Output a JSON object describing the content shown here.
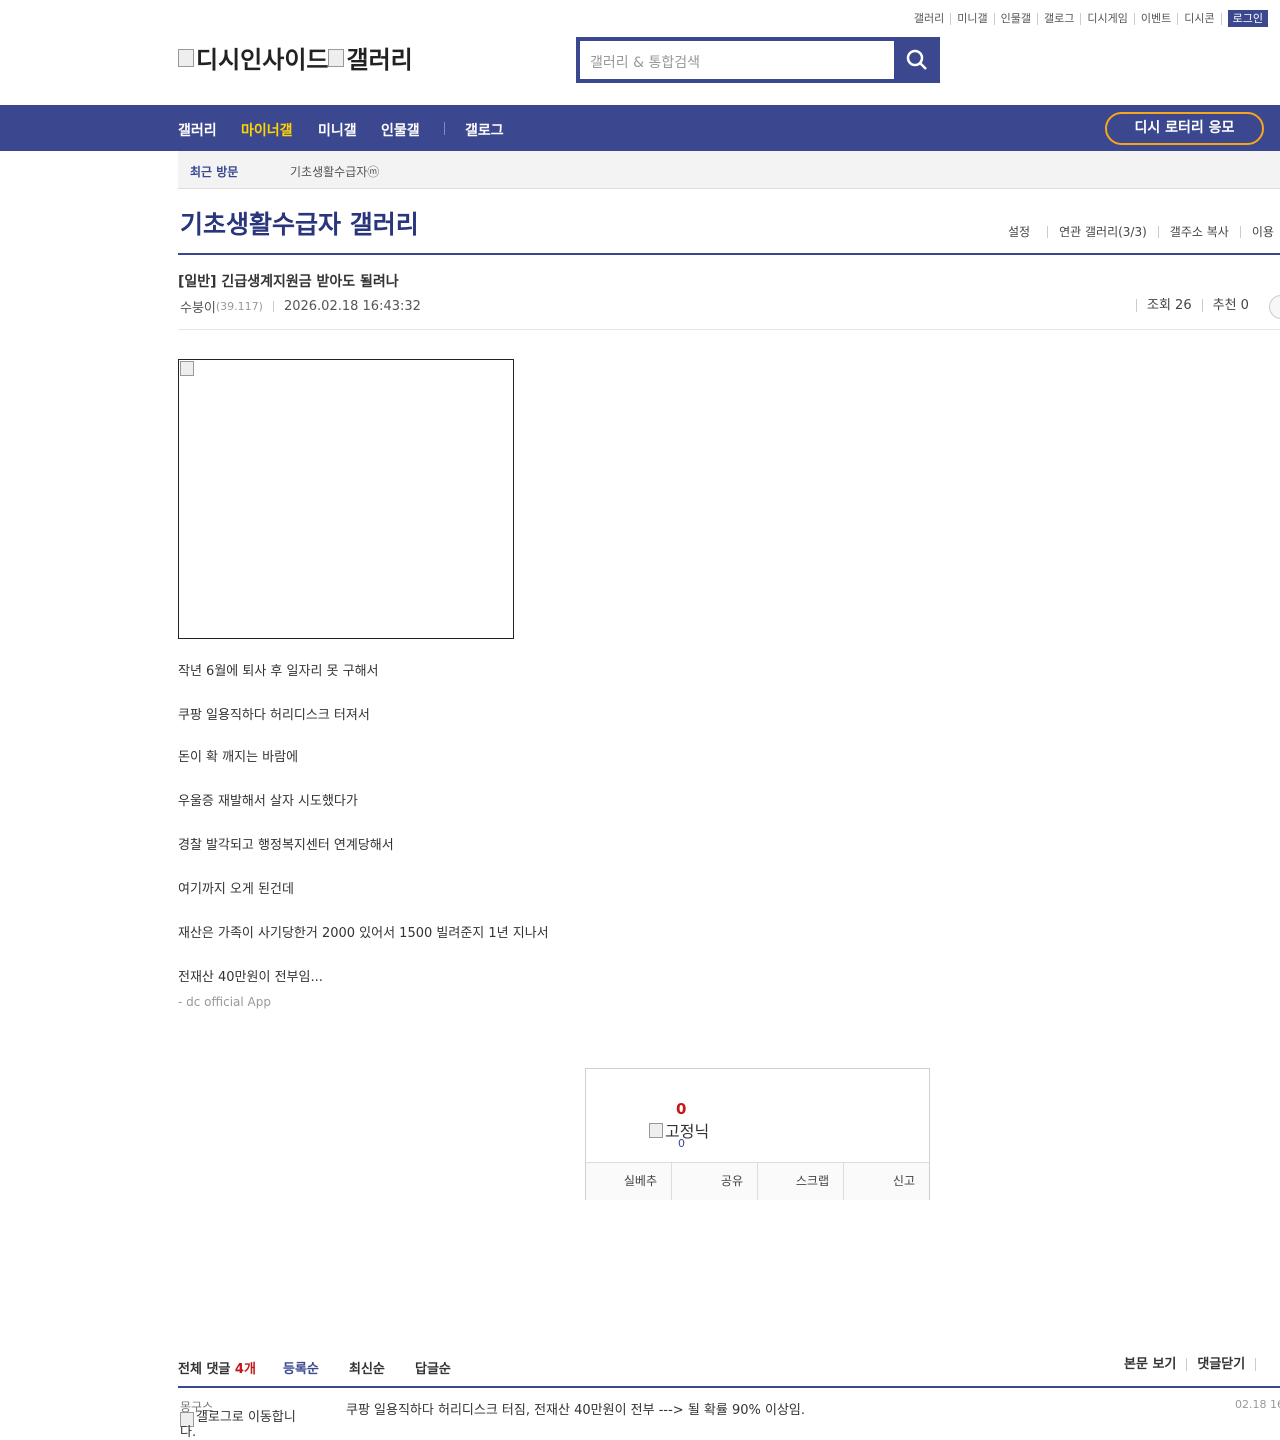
{
  "top_links": [
    "갤러리",
    "미니갤",
    "인물갤",
    "갤로그",
    "디시게임",
    "이벤트",
    "디시콘"
  ],
  "login_label": "로그인",
  "logo": {
    "site_alt": "디시인사이드",
    "gallery_alt": "갤러리"
  },
  "search": {
    "placeholder": "갤러리 & 통합검색"
  },
  "gnb": {
    "items": [
      "갤러리",
      "마이너갤",
      "미니갤",
      "인물갤",
      "갤로그"
    ],
    "active": "마이너갤",
    "lottery": "디시 로터리 응모"
  },
  "recent_visit": {
    "label": "최근 방문",
    "gallery": "기초생활수급자ⓜ"
  },
  "gallery": {
    "title": "기초생활수급자 갤러리",
    "menu": [
      "설정",
      "연관 갤러리(3/3)",
      "갤주소 복사",
      "이용"
    ]
  },
  "post": {
    "title": "[일반] 긴급생계지원금 받아도 될려나",
    "nickname": "수붕이",
    "ip": "(39.117)",
    "date": "2026.02.18 16:43:32",
    "views": "조회 26",
    "recommend": "추천 0",
    "paragraphs": [
      "작년 6월에 퇴사 후 일자리 못 구해서",
      "쿠팡 일용직하다 허리디스크 터져서",
      "돈이 확 깨지는 바람에",
      "우울증 재발해서 살자 시도했다가",
      "경찰 발각되고 행정복지센터 연계당해서",
      "여기까지 오게 된건데",
      "재산은 가족이 사기당한거 2000 있어서 1500 빌려준지 1년 지나서",
      "전재산 40만원이 전부임..."
    ],
    "app_signature": "- dc official App"
  },
  "recommend_box": {
    "count": "0",
    "fixed_nick_alt": "고정닉",
    "fixed_count": "0",
    "buttons": [
      "실베추",
      "공유",
      "스크랩",
      "신고"
    ]
  },
  "comments": {
    "total_label": "전체 댓글",
    "total_count": "4개",
    "sort": [
      "등록순",
      "최신순",
      "답글순"
    ],
    "right": [
      "본문 보기",
      "댓글닫기"
    ],
    "items": [
      {
        "nick": "몽구스",
        "gallog_alt": "갤로그로 이동합니다.",
        "text": "쿠팡 일용직하다 허리디스크 터짐, 전재산 40만원이 전부 ---> 될 확률 90% 이상임.",
        "date": "02.18 16"
      }
    ]
  },
  "colors": {
    "brand": "#3b4890",
    "accent": "#ffd400",
    "lottery_border": "#f7a51b",
    "count_red": "#c4181b"
  }
}
